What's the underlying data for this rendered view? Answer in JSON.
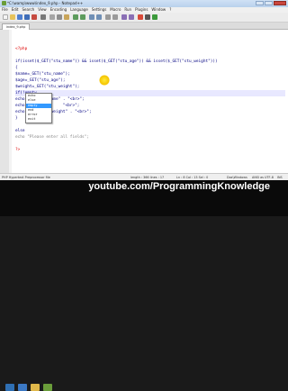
{
  "window": {
    "title": "*C:\\wamp\\www\\index_9.php - Notepad++"
  },
  "menu": [
    "File",
    "Edit",
    "Search",
    "View",
    "Encoding",
    "Language",
    "Settings",
    "Macro",
    "Run",
    "Plugins",
    "Window",
    "?"
  ],
  "tab": {
    "label": "index_9.php"
  },
  "editor": {
    "lines": [
      "<?php",
      "",
      "if(isset($_GET(\"stu_name\")) && isset($_GET(\"stu_age\")) && isset($_GET(\"stu_weight\")))",
      "{",
      "$name=_GET(\"stu_name\");",
      "$age=_GET(\"stu_age\");",
      "$weight=_GET(\"stu_weight\");",
      "if(!empty",
      "echo          name\" . \"<br>\";",
      "echo                \"<br>\";",
      "echo          _weight\" . \"<br>\";",
      "}",
      "",
      "else",
      "echo \"Please enter all fields\";",
      "",
      "?>"
    ],
    "autocomplete": {
      "items": [
        "echo",
        "else",
        "empty",
        "end",
        "error",
        "exit"
      ],
      "selected_index": 2
    }
  },
  "status": {
    "filetype": "PHP Hypertext Preprocessor file",
    "length": "length : 366  lines : 17",
    "position": "Ln : 8  Col : 13  Sel : 0",
    "eol": "Dos\\Windows",
    "encoding": "ANSI as UTF-8",
    "mode": "INS"
  },
  "watermark": "youtube.com/ProgrammingKnowledge"
}
